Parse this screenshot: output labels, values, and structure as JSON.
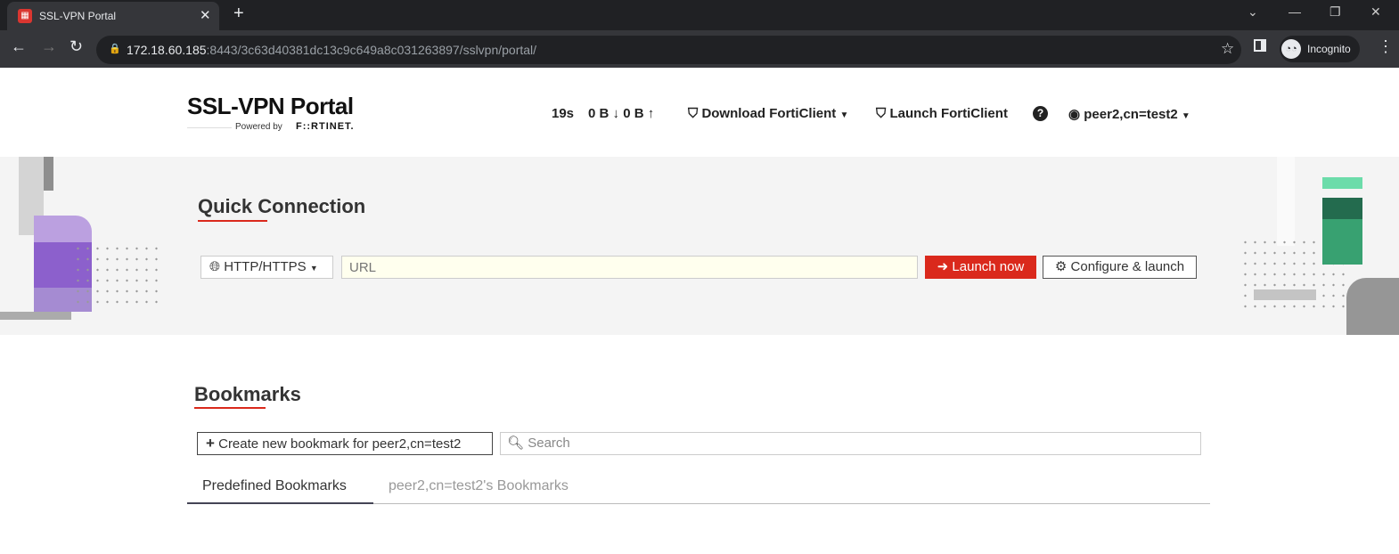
{
  "browser": {
    "tab_title": "SSL-VPN Portal",
    "url_host": "172.18.60.185",
    "url_rest": ":8443/3c63d40381dc13c9c649a8c031263897/sslvpn/portal/",
    "profile": "Incognito"
  },
  "header": {
    "title": "SSL-VPN Portal",
    "powered_by": "Powered by",
    "brand": "F::RTINET.",
    "session_time": "19s",
    "traffic_down": "0 B",
    "traffic_up": "0 B",
    "download_forticlient": "Download FortiClient",
    "launch_forticlient": "Launch FortiClient",
    "user": "peer2,cn=test2"
  },
  "quick_connection": {
    "heading": "Quick Connection",
    "protocol": "HTTP/HTTPS",
    "url_placeholder": "URL",
    "launch_now": "Launch now",
    "configure_launch": "Configure & launch"
  },
  "bookmarks": {
    "heading": "Bookmarks",
    "create_button": "Create new bookmark for peer2,cn=test2",
    "search_placeholder": "Search",
    "tabs": [
      {
        "label": "Predefined Bookmarks",
        "active": true
      },
      {
        "label": "peer2,cn=test2's Bookmarks",
        "active": false
      }
    ]
  },
  "colors": {
    "accent": "#da291c"
  }
}
